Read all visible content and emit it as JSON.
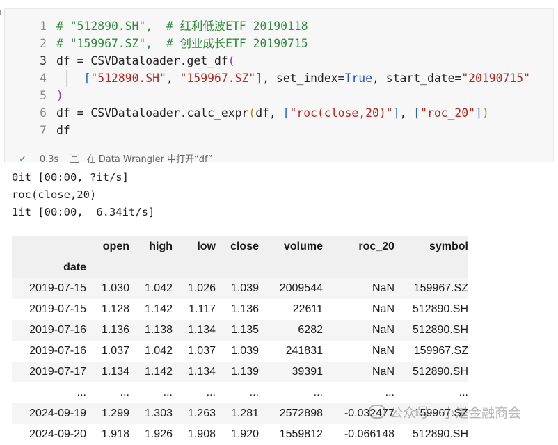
{
  "cell": {
    "lines": [
      {
        "num": "1",
        "parts": [
          {
            "t": "# \"512890.SH\",  # 红利低波ETF 20190118",
            "c": "com"
          }
        ]
      },
      {
        "num": "2",
        "parts": [
          {
            "t": "# \"159967.SZ\",  # 创业成长ETF 20190715",
            "c": "com"
          }
        ]
      },
      {
        "num": "3",
        "parts": [
          {
            "t": "df = CSVDataloader.get_df",
            "c": ""
          },
          {
            "t": "(",
            "c": "br1"
          }
        ]
      },
      {
        "num": "4",
        "parts": [
          {
            "t": "    ",
            "c": ""
          },
          {
            "t": "[",
            "c": "br3"
          },
          {
            "t": "\"512890.SH\"",
            "c": "str"
          },
          {
            "t": ", ",
            "c": ""
          },
          {
            "t": "\"159967.SZ\"",
            "c": "str"
          },
          {
            "t": "]",
            "c": "br3"
          },
          {
            "t": ", set_index=",
            "c": ""
          },
          {
            "t": "True",
            "c": "kw"
          },
          {
            "t": ", start_date=",
            "c": ""
          },
          {
            "t": "\"20190715\"",
            "c": "str"
          }
        ]
      },
      {
        "num": "5",
        "parts": [
          {
            "t": ")",
            "c": "br1"
          }
        ]
      },
      {
        "num": "6",
        "parts": [
          {
            "t": "df = CSVDataloader.calc_expr",
            "c": ""
          },
          {
            "t": "(",
            "c": "br2"
          },
          {
            "t": "df, ",
            "c": ""
          },
          {
            "t": "[",
            "c": "br3"
          },
          {
            "t": "\"roc(close,20)\"",
            "c": "str"
          },
          {
            "t": "]",
            "c": "br3"
          },
          {
            "t": ", ",
            "c": ""
          },
          {
            "t": "[",
            "c": "br3"
          },
          {
            "t": "\"roc_20\"",
            "c": "str"
          },
          {
            "t": "]",
            "c": "br3"
          },
          {
            "t": ")",
            "c": "br2"
          }
        ]
      },
      {
        "num": "7",
        "parts": [
          {
            "t": "df",
            "c": ""
          }
        ]
      }
    ],
    "active_line": "3",
    "status": {
      "time": "0.3s",
      "action": "在 Data Wrangler 中打开“df”"
    }
  },
  "output": {
    "stdout": [
      "0it [00:00, ?it/s]",
      "roc(close,20)",
      "1it [00:00,  6.34it/s]"
    ]
  },
  "dataframe": {
    "columns": [
      "open",
      "high",
      "low",
      "close",
      "volume",
      "roc_20",
      "symbol"
    ],
    "index_name": "date",
    "rows": [
      [
        "2019-07-15",
        "1.030",
        "1.042",
        "1.026",
        "1.039",
        "2009544",
        "NaN",
        "159967.SZ"
      ],
      [
        "2019-07-15",
        "1.128",
        "1.142",
        "1.117",
        "1.136",
        "22611",
        "NaN",
        "512890.SH"
      ],
      [
        "2019-07-16",
        "1.136",
        "1.138",
        "1.134",
        "1.135",
        "6282",
        "NaN",
        "512890.SH"
      ],
      [
        "2019-07-16",
        "1.037",
        "1.042",
        "1.037",
        "1.039",
        "241831",
        "NaN",
        "159967.SZ"
      ],
      [
        "2019-07-17",
        "1.134",
        "1.142",
        "1.134",
        "1.139",
        "39391",
        "NaN",
        "512890.SH"
      ],
      [
        "...",
        "...",
        "...",
        "...",
        "...",
        "...",
        "...",
        "..."
      ],
      [
        "2024-09-19",
        "1.299",
        "1.303",
        "1.263",
        "1.281",
        "2572898",
        "-0.032477",
        "159967.SZ"
      ],
      [
        "2024-09-20",
        "1.918",
        "1.926",
        "1.908",
        "1.920",
        "1559812",
        "-0.066148",
        "512890.SH"
      ]
    ]
  },
  "watermark": "公众号 · 小是金融商会"
}
